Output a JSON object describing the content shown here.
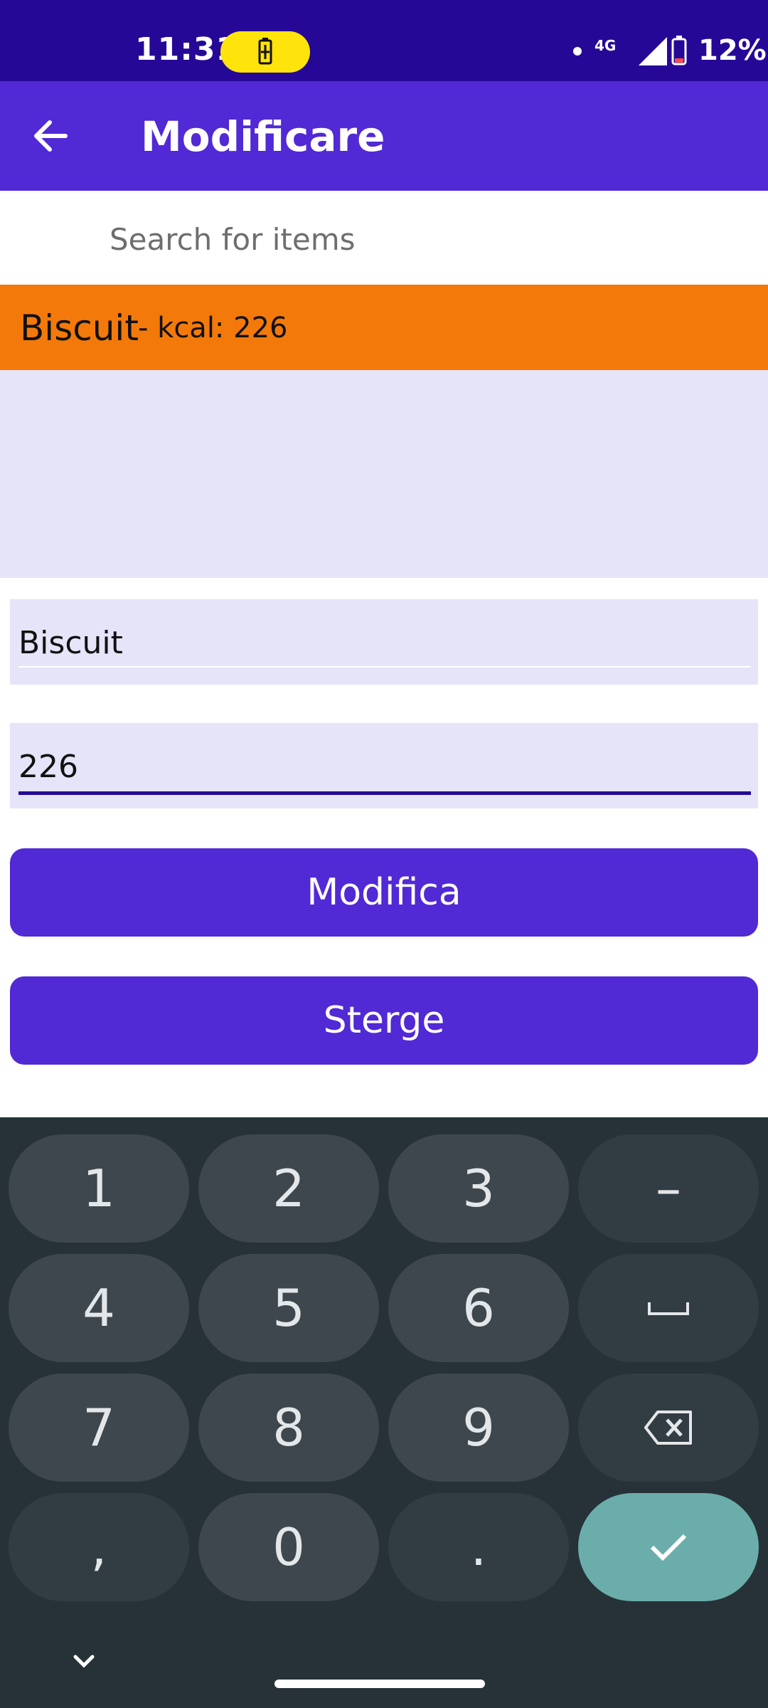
{
  "status_bar": {
    "time": "11:31",
    "network": "4G",
    "battery_percent": "12%",
    "icons": [
      "battery-charging-icon",
      "dot-icon",
      "signal-icon",
      "battery-icon"
    ]
  },
  "app_bar": {
    "title": "Modificare",
    "back_icon": "arrow-back-icon"
  },
  "search": {
    "placeholder": "Search for items",
    "value": ""
  },
  "list": {
    "items": [
      {
        "name": "Biscuit",
        "kcal_text": "- kcal: 226"
      }
    ]
  },
  "form": {
    "name_value": "Biscuit",
    "kcal_value": "226",
    "modify_label": "Modifica",
    "delete_label": "Sterge"
  },
  "keyboard": {
    "rows": [
      [
        "1",
        "2",
        "3",
        "–"
      ],
      [
        "4",
        "5",
        "6",
        "␣"
      ],
      [
        "7",
        "8",
        "9",
        "⌫"
      ],
      [
        ",",
        "0",
        ".",
        "✓"
      ]
    ]
  },
  "colors": {
    "status_bar": "#250996",
    "primary": "#5129d5",
    "list_item": "#f37a0a",
    "field_bg": "#e5e4f8",
    "keyboard_bg": "#263238",
    "key_bg": "#3e474d",
    "enter_key": "#6badaa"
  }
}
